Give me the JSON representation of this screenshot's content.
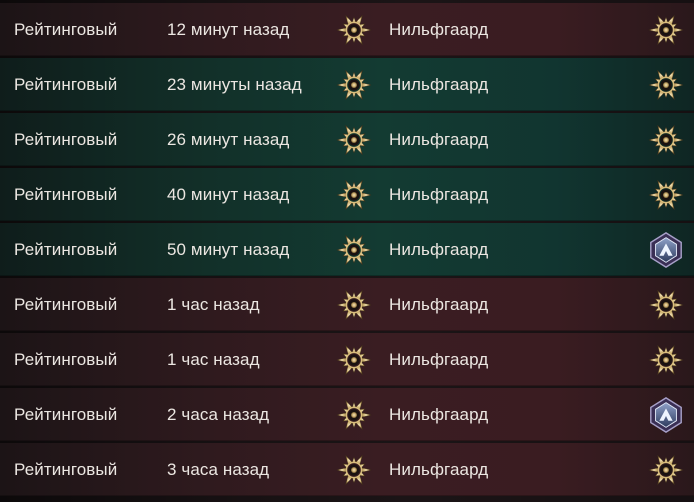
{
  "matches": [
    {
      "mode": "Рейтинговый",
      "time": "12 минут назад",
      "faction": "Нильфгаард",
      "result": "loss",
      "faction_icon": "nilfgaard-sun-icon",
      "rank_icon": "sun-rank-icon"
    },
    {
      "mode": "Рейтинговый",
      "time": "23 минуты назад",
      "faction": "Нильфгаард",
      "result": "win",
      "faction_icon": "nilfgaard-sun-icon",
      "rank_icon": "sun-rank-icon"
    },
    {
      "mode": "Рейтинговый",
      "time": "26 минут назад",
      "faction": "Нильфгаард",
      "result": "win",
      "faction_icon": "nilfgaard-sun-icon",
      "rank_icon": "sun-rank-icon"
    },
    {
      "mode": "Рейтинговый",
      "time": "40 минут назад",
      "faction": "Нильфгаард",
      "result": "win",
      "faction_icon": "nilfgaard-sun-icon",
      "rank_icon": "sun-rank-icon"
    },
    {
      "mode": "Рейтинговый",
      "time": "50 минут назад",
      "faction": "Нильфгаард",
      "result": "win",
      "faction_icon": "nilfgaard-sun-icon",
      "rank_icon": "skellige-rank-icon"
    },
    {
      "mode": "Рейтинговый",
      "time": "1 час назад",
      "faction": "Нильфгаард",
      "result": "loss",
      "faction_icon": "nilfgaard-sun-icon",
      "rank_icon": "sun-rank-icon"
    },
    {
      "mode": "Рейтинговый",
      "time": "1 час назад",
      "faction": "Нильфгаард",
      "result": "loss",
      "faction_icon": "nilfgaard-sun-icon",
      "rank_icon": "sun-rank-icon"
    },
    {
      "mode": "Рейтинговый",
      "time": "2 часа назад",
      "faction": "Нильфгаард",
      "result": "loss",
      "faction_icon": "nilfgaard-sun-icon",
      "rank_icon": "skellige-rank-icon"
    },
    {
      "mode": "Рейтинговый",
      "time": "3 часа назад",
      "faction": "Нильфгаард",
      "result": "loss",
      "faction_icon": "nilfgaard-sun-icon",
      "rank_icon": "sun-rank-icon"
    }
  ],
  "colors": {
    "win_row": "#133b32",
    "loss_row": "#3a1d22",
    "text": "#ece7e2",
    "sun_gold": "#c9ab6a"
  }
}
